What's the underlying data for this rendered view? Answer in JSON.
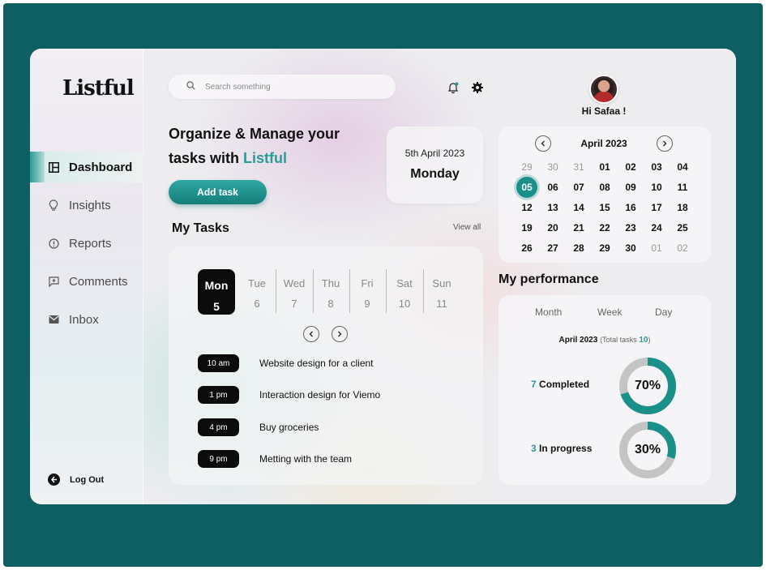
{
  "app": {
    "logo": "Listful"
  },
  "sidebar": {
    "items": [
      {
        "label": "Dashboard",
        "icon": "dashboard-icon",
        "active": true
      },
      {
        "label": "Insights",
        "icon": "lightbulb-icon",
        "active": false
      },
      {
        "label": "Reports",
        "icon": "info-icon",
        "active": false
      },
      {
        "label": "Comments",
        "icon": "comment-icon",
        "active": false
      },
      {
        "label": "Inbox",
        "icon": "inbox-icon",
        "active": false
      }
    ],
    "logout_label": "Log Out"
  },
  "header": {
    "search_placeholder": "Search something",
    "greeting": "Hi Safaa !"
  },
  "hero": {
    "title_line1": "Organize & Manage your",
    "title_line2_prefix": "tasks with",
    "title_accent": "Listful",
    "add_task_label": "Add task"
  },
  "date_card": {
    "date": "5th April 2023",
    "weekday": "Monday"
  },
  "my_tasks": {
    "title": "My Tasks",
    "view_all_label": "View all",
    "days": [
      {
        "name": "Mon",
        "date": "5",
        "active": true
      },
      {
        "name": "Tue",
        "date": "6"
      },
      {
        "name": "Wed",
        "date": "7"
      },
      {
        "name": "Thu",
        "date": "8"
      },
      {
        "name": "Fri",
        "date": "9"
      },
      {
        "name": "Sat",
        "date": "10"
      },
      {
        "name": "Sun",
        "date": "11"
      }
    ],
    "tasks": [
      {
        "time": "10 am",
        "text": "Website design for a client"
      },
      {
        "time": "1 pm",
        "text": "Interaction  design for Viemo"
      },
      {
        "time": "4 pm",
        "text": "Buy groceries"
      },
      {
        "time": "9 pm",
        "text": "Metting with the team"
      }
    ]
  },
  "calendar": {
    "month_label": "April  2023",
    "weeks": [
      [
        "29",
        "30",
        "31",
        "01",
        "02",
        "03",
        "04"
      ],
      [
        "05",
        "06",
        "07",
        "08",
        "09",
        "10",
        "11"
      ],
      [
        "12",
        "13",
        "14",
        "15",
        "16",
        "17",
        "18"
      ],
      [
        "19",
        "20",
        "21",
        "22",
        "23",
        "24",
        "25"
      ],
      [
        "26",
        "27",
        "28",
        "29",
        "30",
        "01",
        "02"
      ]
    ],
    "muted": [
      [
        0,
        0
      ],
      [
        0,
        1
      ],
      [
        0,
        2
      ],
      [
        4,
        5
      ],
      [
        4,
        6
      ]
    ],
    "selected": [
      1,
      0
    ]
  },
  "performance": {
    "title": "My performance",
    "tabs": [
      "Month",
      "Week",
      "Day"
    ],
    "active_tab": 0,
    "period": "April 2023",
    "total_prefix": "(Total tasks",
    "total_value": "10",
    "total_suffix": ")",
    "stats": [
      {
        "count": "7",
        "label": "Completed",
        "percent_label": "70%",
        "value": 0.7
      },
      {
        "count": "3",
        "label": "In progress",
        "percent_label": "30%",
        "value": 0.3
      }
    ],
    "colors": {
      "accent": "#1b8f8a",
      "track": "#c4c4c4"
    }
  }
}
